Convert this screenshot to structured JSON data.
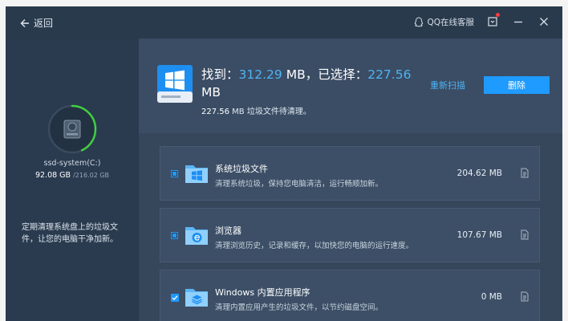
{
  "titlebar": {
    "back_label": "返回",
    "support_label": "QQ在线客服",
    "icons": [
      "back-arrow-icon",
      "qq-icon",
      "feedback-icon",
      "minimize-icon",
      "close-icon"
    ]
  },
  "drive": {
    "name": "ssd-system(C:)",
    "used": "92.08 GB",
    "total": "/216.02 GB",
    "used_fraction": 0.43,
    "ring_color": "#3fcf3f"
  },
  "left_hint": "定期清理系统盘上的垃圾文件，让您的电脑干净加新。",
  "summary": {
    "found_label": "找到：",
    "found_value": "312.29",
    "unit1": " MB，已选择：",
    "selected_value": "227.56",
    "unit2": "MB",
    "selected_size": "227.56",
    "selected_suffix": " MB 垃圾文件待清理。",
    "rescan_label": "重新扫描",
    "delete_label": "删除"
  },
  "items": [
    {
      "name": "系统垃圾文件",
      "desc": "清理系统垃圾，保持您电脑清洁，运行畅顺加新。",
      "size": "204.62 MB",
      "state": "partial",
      "icon": "windows-folder-icon"
    },
    {
      "name": "浏览器",
      "desc": "清理浏览历史，记录和缓存，以加快您的电脑的运行速度。",
      "size": "107.67 MB",
      "state": "partial",
      "icon": "browser-folder-icon"
    },
    {
      "name": "Windows 内置应用程序",
      "desc": "清理内置应用产生的垃圾文件，以节约磁盘空间。",
      "size": "0 MB",
      "state": "checked",
      "icon": "apps-folder-icon"
    }
  ],
  "colors": {
    "accent": "#1f9bff",
    "highlight": "#4db3f2",
    "bg_dark": "#2b3b4e"
  }
}
